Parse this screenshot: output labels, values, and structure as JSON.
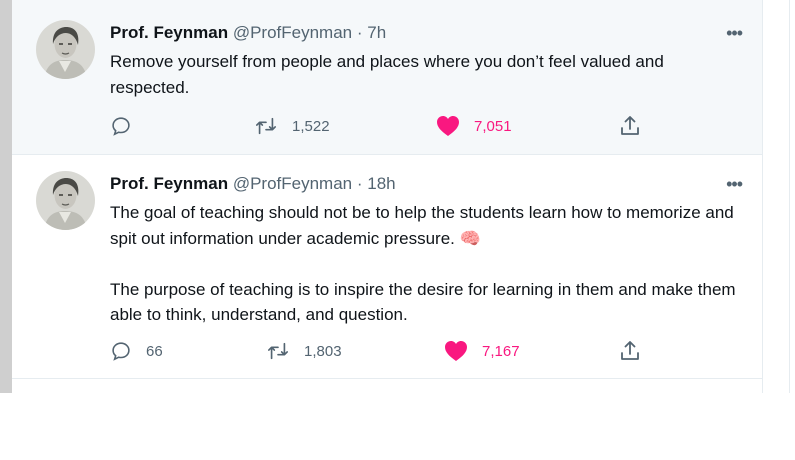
{
  "tweets": [
    {
      "name": "Prof. Feynman",
      "handle": "@ProfFeynman",
      "time": "· 7h",
      "more_icon": "•••",
      "text": "Remove yourself from people and places where you don’t feel valued and respected.",
      "reply_count": "",
      "retweet_count": "1,522",
      "like_count": "7,051",
      "liked": true
    },
    {
      "name": "Prof. Feynman",
      "handle": "@ProfFeynman",
      "time": "· 18h",
      "more_icon": "•••",
      "text": "The goal of teaching should not be to help the students learn how to memorize and spit out information under academic pressure. 🧠\n\nThe purpose of teaching is to inspire the desire for learning in them and make them able to think, understand, and question.",
      "reply_count": "66",
      "retweet_count": "1,803",
      "like_count": "7,167",
      "liked": true
    }
  ],
  "colors": {
    "like": "#f91880",
    "icon": "#536471",
    "text": "#0f1419",
    "hover_bg": "#f5f8fa"
  },
  "icons": [
    "avatar",
    "reply-icon",
    "retweet-icon",
    "heart-icon",
    "share-icon",
    "more-icon"
  ]
}
